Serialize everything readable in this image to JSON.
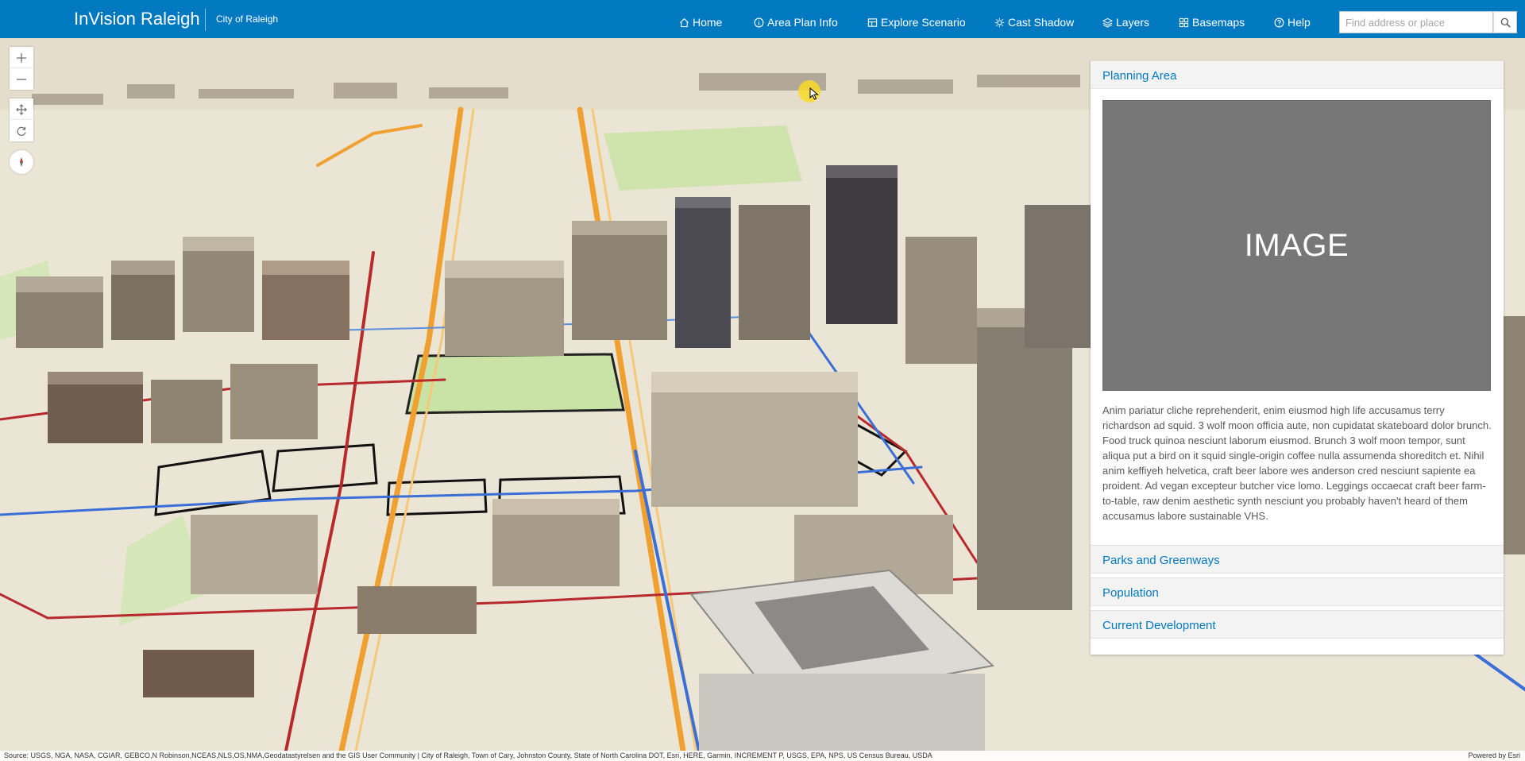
{
  "header": {
    "app_title": "InVision Raleigh",
    "org_name": "City of Raleigh",
    "nav": [
      {
        "label": "Home",
        "icon": "home-icon"
      },
      {
        "label": "Area Plan Info",
        "icon": "info-icon"
      },
      {
        "label": "Explore Scenario",
        "icon": "scenario-icon"
      },
      {
        "label": "Cast Shadow",
        "icon": "sun-icon"
      },
      {
        "label": "Layers",
        "icon": "layers-icon"
      },
      {
        "label": "Basemaps",
        "icon": "basemap-icon"
      },
      {
        "label": "Help",
        "icon": "help-icon"
      }
    ],
    "search": {
      "placeholder": "Find address or place",
      "value": ""
    }
  },
  "map_controls": [
    "zoom-in-icon",
    "zoom-out-icon",
    "pan-icon",
    "rotate-icon",
    "compass-icon"
  ],
  "panel": {
    "sections": [
      {
        "title": "Planning Area",
        "expanded": true,
        "image_label": "IMAGE",
        "body": "Anim pariatur cliche reprehenderit, enim eiusmod high life accusamus terry richardson ad squid. 3 wolf moon officia aute, non cupidatat skateboard dolor brunch. Food truck quinoa nesciunt laborum eiusmod. Brunch 3 wolf moon tempor, sunt aliqua put a bird on it squid single-origin coffee nulla assumenda shoreditch et. Nihil anim keffiyeh helvetica, craft beer labore wes anderson cred nesciunt sapiente ea proident. Ad vegan excepteur butcher vice lomo. Leggings occaecat craft beer farm-to-table, raw denim aesthetic synth nesciunt you probably haven't heard of them accusamus labore sustainable VHS."
      },
      {
        "title": "Parks and Greenways",
        "expanded": false
      },
      {
        "title": "Population",
        "expanded": false
      },
      {
        "title": "Current Development",
        "expanded": false
      }
    ]
  },
  "attribution": {
    "source": "Source: USGS, NGA, NASA, CGIAR, GEBCO,N Robinson,NCEAS,NLS,OS,NMA,Geodatastyrelsen and the GIS User Community | City of Raleigh, Town of Cary, Johnston County, State of North Carolina DOT, Esri, HERE, Garmin, INCREMENT P, USGS, EPA, NPS, US Census Bureau, USDA",
    "powered_by": "Powered by Esri"
  },
  "colors": {
    "header_bg": "#0079c1",
    "accent": "#0079c1",
    "road_red": "#c0392b",
    "road_orange": "#f0a030",
    "road_blue": "#3a6fd8",
    "park_green": "#c9e2a6"
  }
}
